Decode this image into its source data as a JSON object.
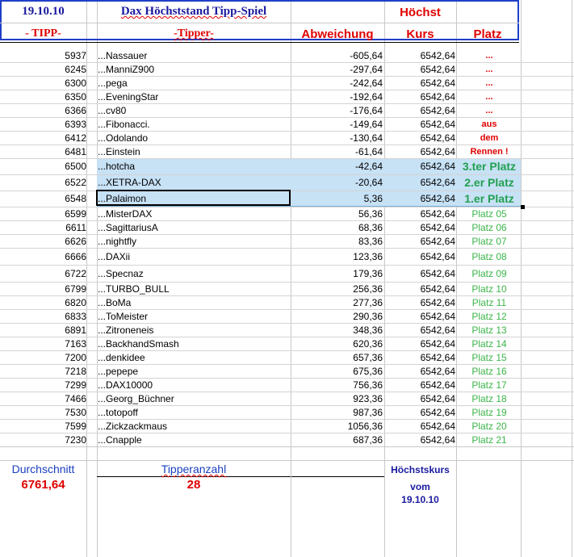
{
  "header": {
    "date": "19.10.10",
    "title": "Dax Höchststand Tipp-Spiel",
    "col_tipp": "- TIPP-",
    "col_tipper": "-Tipper-",
    "col_diff": "Abweichung",
    "col_kurs_top": "Höchst",
    "col_kurs": "Kurs",
    "col_platz": "Platz"
  },
  "rows": [
    {
      "tipp": "5937",
      "name": "...Nassauer",
      "diff": "-605,64",
      "kurs": "6542,64",
      "platz": "...",
      "style": "red"
    },
    {
      "tipp": "6245",
      "name": "...ManniZ900",
      "diff": "-297,64",
      "kurs": "6542,64",
      "platz": "...",
      "style": "red"
    },
    {
      "tipp": "6300",
      "name": "...pega",
      "diff": "-242,64",
      "kurs": "6542,64",
      "platz": "...",
      "style": "red"
    },
    {
      "tipp": "6350",
      "name": "...EveningStar",
      "diff": "-192,64",
      "kurs": "6542,64",
      "platz": "...",
      "style": "red"
    },
    {
      "tipp": "6366",
      "name": "...cv80",
      "diff": "-176,64",
      "kurs": "6542,64",
      "platz": "...",
      "style": "red"
    },
    {
      "tipp": "6393",
      "name": "...Fibonacci.",
      "diff": "-149,64",
      "kurs": "6542,64",
      "platz": "aus",
      "style": "red"
    },
    {
      "tipp": "6412",
      "name": "...Odolando",
      "diff": "-130,64",
      "kurs": "6542,64",
      "platz": "dem",
      "style": "red"
    },
    {
      "tipp": "6481",
      "name": "...Einstein",
      "diff": "-61,64",
      "kurs": "6542,64",
      "platz": "Rennen !",
      "style": "red"
    },
    {
      "tipp": "6500",
      "name": "...hotcha",
      "diff": "-42,64",
      "kurs": "6542,64",
      "platz": "3.ter Platz",
      "style": "top"
    },
    {
      "tipp": "6522",
      "name": "...XETRA-DAX",
      "diff": "-20,64",
      "kurs": "6542,64",
      "platz": "2.er Platz",
      "style": "top"
    },
    {
      "tipp": "6548",
      "name": "...Palaimon",
      "diff": "5,36",
      "kurs": "6542,64",
      "platz": "1.er Platz",
      "style": "top"
    },
    {
      "tipp": "6599",
      "name": "...MisterDAX",
      "diff": "56,36",
      "kurs": "6542,64",
      "platz": "Platz 05",
      "style": "green"
    },
    {
      "tipp": "6611",
      "name": "...SagittariusA",
      "diff": "68,36",
      "kurs": "6542,64",
      "platz": "Platz 06",
      "style": "green"
    },
    {
      "tipp": "6626",
      "name": "...nightfly",
      "diff": "83,36",
      "kurs": "6542,64",
      "platz": "Platz 07",
      "style": "green"
    },
    {
      "tipp": "6666",
      "name": "...DAXii",
      "diff": "123,36",
      "kurs": "6542,64",
      "platz": "Platz 08",
      "style": "green"
    },
    {
      "tipp": "6722",
      "name": "...Specnaz",
      "diff": "179,36",
      "kurs": "6542,64",
      "platz": "Platz 09",
      "style": "green"
    },
    {
      "tipp": "6799",
      "name": "...TURBO_BULL",
      "diff": "256,36",
      "kurs": "6542,64",
      "platz": "Platz 10",
      "style": "green"
    },
    {
      "tipp": "6820",
      "name": "...BoMa",
      "diff": "277,36",
      "kurs": "6542,64",
      "platz": "Platz 11",
      "style": "green"
    },
    {
      "tipp": "6833",
      "name": "...ToMeister",
      "diff": "290,36",
      "kurs": "6542,64",
      "platz": "Platz 12",
      "style": "green"
    },
    {
      "tipp": "6891",
      "name": "...Zitroneneis",
      "diff": "348,36",
      "kurs": "6542,64",
      "platz": "Platz 13",
      "style": "green"
    },
    {
      "tipp": "7163",
      "name": "...BackhandSmash",
      "diff": "620,36",
      "kurs": "6542,64",
      "platz": "Platz 14",
      "style": "green"
    },
    {
      "tipp": "7200",
      "name": "...denkidee",
      "diff": "657,36",
      "kurs": "6542,64",
      "platz": "Platz 15",
      "style": "green"
    },
    {
      "tipp": "7218",
      "name": "...pepepe",
      "diff": "675,36",
      "kurs": "6542,64",
      "platz": "Platz 16",
      "style": "green"
    },
    {
      "tipp": "7299",
      "name": "...DAX10000",
      "diff": "756,36",
      "kurs": "6542,64",
      "platz": "Platz 17",
      "style": "green"
    },
    {
      "tipp": "7466",
      "name": "...Georg_Büchner",
      "diff": "923,36",
      "kurs": "6542,64",
      "platz": "Platz 18",
      "style": "green"
    },
    {
      "tipp": "7530",
      "name": "...totopoff",
      "diff": "987,36",
      "kurs": "6542,64",
      "platz": "Platz 19",
      "style": "green"
    },
    {
      "tipp": "7599",
      "name": "...Zickzackmaus",
      "diff": "1056,36",
      "kurs": "6542,64",
      "platz": "Platz 20",
      "style": "green"
    },
    {
      "tipp": "7230",
      "name": "...Cnapple",
      "diff": "687,36",
      "kurs": "6542,64",
      "platz": "Platz 21",
      "style": "green"
    }
  ],
  "footer": {
    "avg_label": "Durchschnitt",
    "avg_value": "6761,64",
    "count_label": "Tipperanzahl",
    "count_value": "28",
    "max_label": "Höchstskurs",
    "max_vom": "vom",
    "max_date": "19.10.10"
  },
  "colors": {
    "header_border": "#1f3fc8",
    "title_blue": "#1a1aa0",
    "red": "#e00000",
    "green_top": "#22a050",
    "green": "#3cb54a",
    "highlight": "#c7e1f5"
  }
}
